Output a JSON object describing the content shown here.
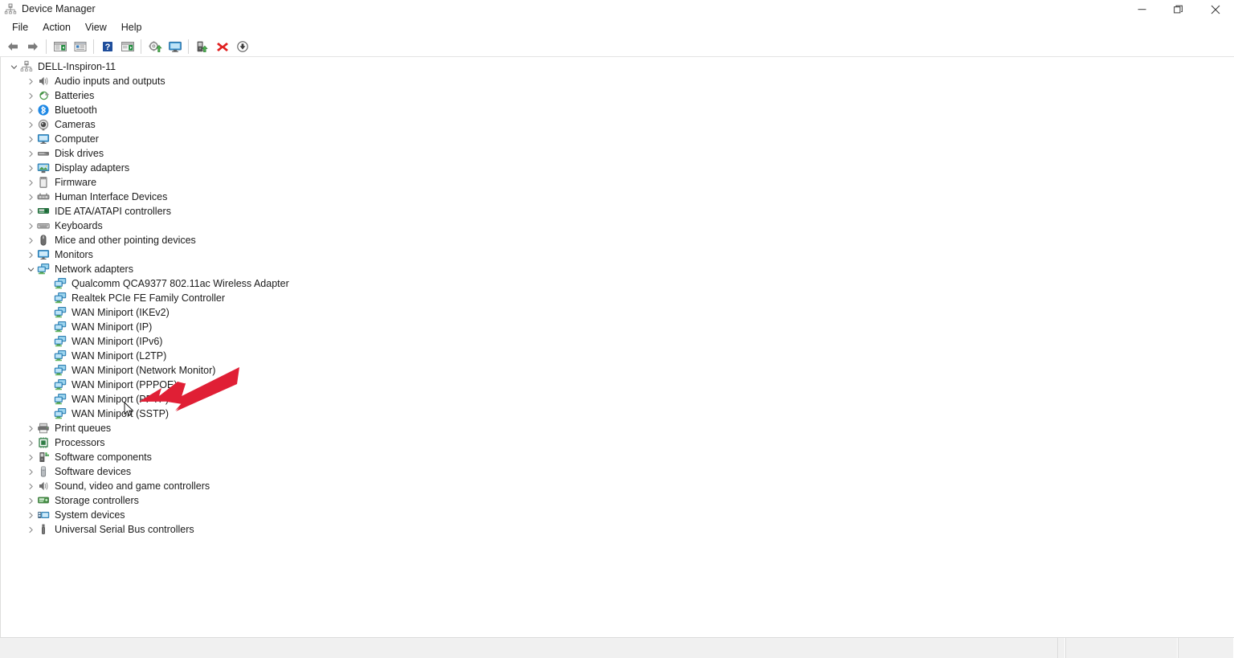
{
  "window": {
    "title": "Device Manager",
    "app_icon": "device-manager-icon",
    "controls": {
      "minimize": "Minimize",
      "maximize": "Restore",
      "close": "Close"
    }
  },
  "menubar": {
    "items": [
      {
        "label": "File",
        "name": "menu-file"
      },
      {
        "label": "Action",
        "name": "menu-action"
      },
      {
        "label": "View",
        "name": "menu-view"
      },
      {
        "label": "Help",
        "name": "menu-help"
      }
    ]
  },
  "toolbar": {
    "buttons": [
      {
        "name": "back-button",
        "icon": "back-arrow-icon",
        "tooltip": "Back"
      },
      {
        "name": "forward-button",
        "icon": "forward-arrow-icon",
        "tooltip": "Forward"
      },
      {
        "name": "show-hide-console-tree-button",
        "icon": "console-tree-icon",
        "tooltip": "Show/Hide Console Tree"
      },
      {
        "name": "properties-button",
        "icon": "properties-icon",
        "tooltip": "Properties"
      },
      {
        "name": "help-button",
        "icon": "help-question-icon",
        "tooltip": "Help"
      },
      {
        "name": "view-button",
        "icon": "view-window-icon",
        "tooltip": "View"
      },
      {
        "name": "update-driver-button",
        "icon": "update-driver-icon",
        "tooltip": "Update driver"
      },
      {
        "name": "remote-desktop-button",
        "icon": "monitor-icon",
        "tooltip": "Remote Desktop"
      },
      {
        "name": "scan-hardware-changes-button",
        "icon": "scan-hardware-icon",
        "tooltip": "Scan for hardware changes"
      },
      {
        "name": "uninstall-device-button",
        "icon": "red-x-icon",
        "tooltip": "Uninstall device"
      },
      {
        "name": "disable-device-button",
        "icon": "down-arrow-circle-icon",
        "tooltip": "Disable device"
      }
    ]
  },
  "tree": {
    "root": {
      "label": "DELL-Inspiron-11",
      "icon": "computer-root-icon",
      "expanded": true,
      "indent": 0
    },
    "nodes": [
      {
        "label": "Audio inputs and outputs",
        "icon": "speaker-icon",
        "indent": 1,
        "expandable": true,
        "expanded": false
      },
      {
        "label": "Batteries",
        "icon": "battery-icon",
        "indent": 1,
        "expandable": true,
        "expanded": false
      },
      {
        "label": "Bluetooth",
        "icon": "bluetooth-icon",
        "indent": 1,
        "expandable": true,
        "expanded": false
      },
      {
        "label": "Cameras",
        "icon": "camera-icon",
        "indent": 1,
        "expandable": true,
        "expanded": false
      },
      {
        "label": "Computer",
        "icon": "computer-icon",
        "indent": 1,
        "expandable": true,
        "expanded": false
      },
      {
        "label": "Disk drives",
        "icon": "disk-drive-icon",
        "indent": 1,
        "expandable": true,
        "expanded": false
      },
      {
        "label": "Display adapters",
        "icon": "display-adapter-icon",
        "indent": 1,
        "expandable": true,
        "expanded": false
      },
      {
        "label": "Firmware",
        "icon": "firmware-icon",
        "indent": 1,
        "expandable": true,
        "expanded": false
      },
      {
        "label": "Human Interface Devices",
        "icon": "hid-icon",
        "indent": 1,
        "expandable": true,
        "expanded": false
      },
      {
        "label": "IDE ATA/ATAPI controllers",
        "icon": "ide-controller-icon",
        "indent": 1,
        "expandable": true,
        "expanded": false
      },
      {
        "label": "Keyboards",
        "icon": "keyboard-icon",
        "indent": 1,
        "expandable": true,
        "expanded": false
      },
      {
        "label": "Mice and other pointing devices",
        "icon": "mouse-icon",
        "indent": 1,
        "expandable": true,
        "expanded": false
      },
      {
        "label": "Monitors",
        "icon": "monitor-icon",
        "indent": 1,
        "expandable": true,
        "expanded": false
      },
      {
        "label": "Network adapters",
        "icon": "network-adapter-icon",
        "indent": 1,
        "expandable": true,
        "expanded": true
      },
      {
        "label": "Qualcomm QCA9377 802.11ac Wireless Adapter",
        "icon": "network-adapter-icon",
        "indent": 2,
        "expandable": false,
        "expanded": false
      },
      {
        "label": "Realtek PCIe FE Family Controller",
        "icon": "network-adapter-icon",
        "indent": 2,
        "expandable": false,
        "expanded": false
      },
      {
        "label": "WAN Miniport (IKEv2)",
        "icon": "network-adapter-icon",
        "indent": 2,
        "expandable": false,
        "expanded": false
      },
      {
        "label": "WAN Miniport (IP)",
        "icon": "network-adapter-icon",
        "indent": 2,
        "expandable": false,
        "expanded": false
      },
      {
        "label": "WAN Miniport (IPv6)",
        "icon": "network-adapter-icon",
        "indent": 2,
        "expandable": false,
        "expanded": false
      },
      {
        "label": "WAN Miniport (L2TP)",
        "icon": "network-adapter-icon",
        "indent": 2,
        "expandable": false,
        "expanded": false
      },
      {
        "label": "WAN Miniport (Network Monitor)",
        "icon": "network-adapter-icon",
        "indent": 2,
        "expandable": false,
        "expanded": false
      },
      {
        "label": "WAN Miniport (PPPOE)",
        "icon": "network-adapter-icon",
        "indent": 2,
        "expandable": false,
        "expanded": false
      },
      {
        "label": "WAN Miniport (PPTP)",
        "icon": "network-adapter-icon",
        "indent": 2,
        "expandable": false,
        "expanded": false
      },
      {
        "label": "WAN Miniport (SSTP)",
        "icon": "network-adapter-icon",
        "indent": 2,
        "expandable": false,
        "expanded": false
      },
      {
        "label": "Print queues",
        "icon": "printer-icon",
        "indent": 1,
        "expandable": true,
        "expanded": false
      },
      {
        "label": "Processors",
        "icon": "processor-icon",
        "indent": 1,
        "expandable": true,
        "expanded": false
      },
      {
        "label": "Software components",
        "icon": "software-component-icon",
        "indent": 1,
        "expandable": true,
        "expanded": false
      },
      {
        "label": "Software devices",
        "icon": "software-device-icon",
        "indent": 1,
        "expandable": true,
        "expanded": false
      },
      {
        "label": "Sound, video and game controllers",
        "icon": "speaker-icon",
        "indent": 1,
        "expandable": true,
        "expanded": false
      },
      {
        "label": "Storage controllers",
        "icon": "storage-controller-icon",
        "indent": 1,
        "expandable": true,
        "expanded": false
      },
      {
        "label": "System devices",
        "icon": "system-device-icon",
        "indent": 1,
        "expandable": true,
        "expanded": false
      },
      {
        "label": "Universal Serial Bus controllers",
        "icon": "usb-icon",
        "indent": 1,
        "expandable": true,
        "expanded": false
      }
    ]
  },
  "annotation": {
    "arrow": {
      "name": "red-annotation-arrow",
      "color": "#e01f35",
      "points_to": "WAN Miniport (IPv6)"
    },
    "cursor": {
      "name": "mouse-cursor",
      "type": "arrow"
    }
  },
  "statusbar": {
    "panes": [
      "",
      "",
      ""
    ]
  },
  "colors": {
    "window_bg": "#ffffff",
    "text": "#1b1b1b",
    "toolbar_border": "#e3e3e3",
    "status_bg": "#f0f0f0",
    "accent_red": "#e01f35",
    "network_icon_blue": "#3c9fd6",
    "network_icon_green": "#6cb33f"
  }
}
